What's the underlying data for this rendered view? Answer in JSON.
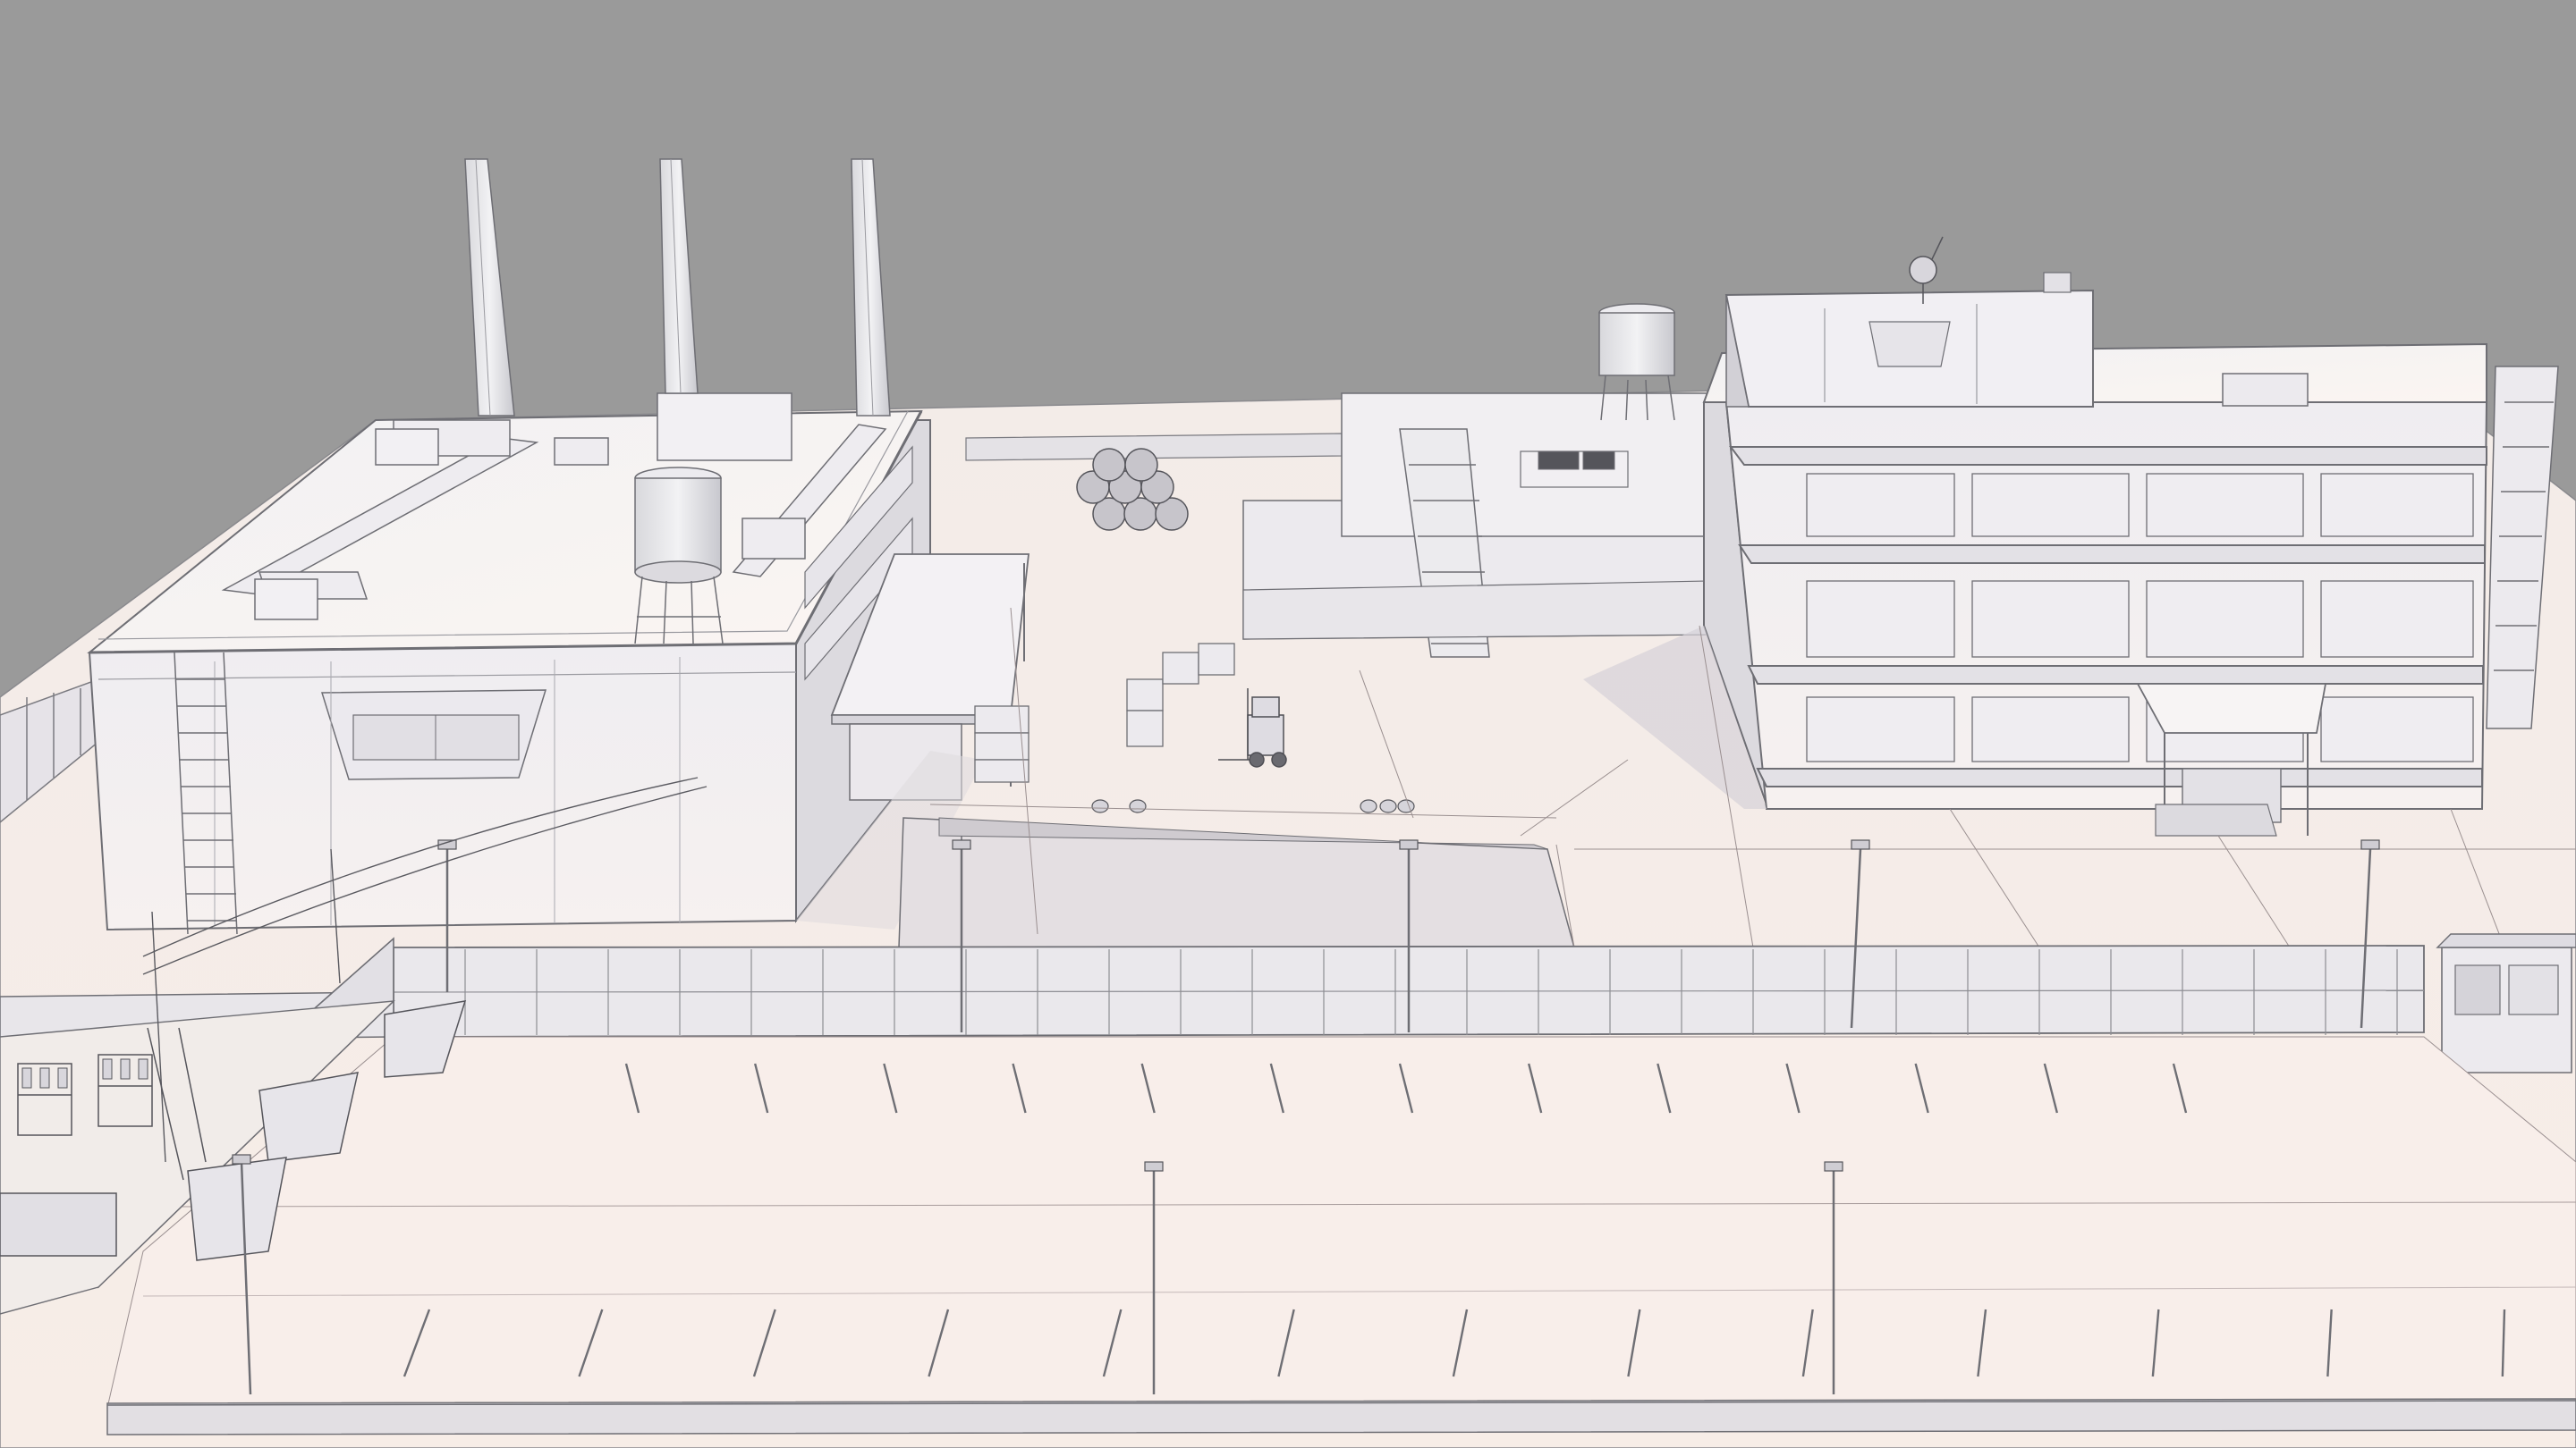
{
  "scene": {
    "kind": "industrial-site-clay-render",
    "colors": {
      "sky": "#9a9a9a",
      "ground": "#f6ebe6",
      "ground_shade": "#e9dcd6",
      "wall_light": "#f4f1f2",
      "wall_mid": "#e4e2e6",
      "wall_dark": "#cfcdd3",
      "shadow": "#c9c4cc",
      "line": "#7a7a80",
      "warm_light": "#fff1e8"
    },
    "parking": {
      "rows": 2,
      "stalls_per_row": 13
    },
    "smokestacks": 3,
    "water_towers": 2,
    "light_poles": 8
  }
}
